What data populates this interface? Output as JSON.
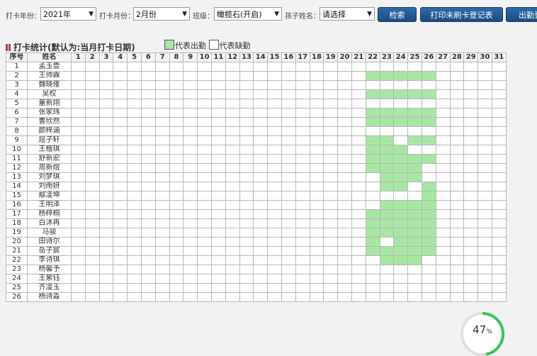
{
  "toolbar": {
    "year_label": "打卡年份：",
    "year_value": "2021年",
    "month_label": "打卡月份：",
    "month_value": "2月份",
    "class_label": "班级：",
    "class_value": "橄榄石(开启)",
    "child_label": "孩子姓名：",
    "child_value": "请选择",
    "search_button": "检索",
    "print_button": "打印未刷卡登记表",
    "export_button": "出勤登"
  },
  "section_title": "打卡统计(默认为:当月打卡日期)",
  "legend": {
    "present": "代表出勤",
    "absent": "代表缺勤"
  },
  "colors": {
    "present": "#a8e6a3",
    "button": "#1f5a97"
  },
  "table": {
    "col_seq": "序号",
    "col_name": "姓名",
    "days": [
      "1",
      "2",
      "3",
      "4",
      "5",
      "6",
      "7",
      "8",
      "9",
      "10",
      "11",
      "12",
      "13",
      "14",
      "15",
      "16",
      "17",
      "18",
      "19",
      "20",
      "21",
      "22",
      "23",
      "24",
      "25",
      "26",
      "27",
      "28",
      "29",
      "30",
      "31"
    ],
    "rows": [
      {
        "seq": "1",
        "name": "孟玉壹",
        "present": []
      },
      {
        "seq": "2",
        "name": "王帅霖",
        "present": [
          22,
          23,
          24,
          25,
          26
        ]
      },
      {
        "seq": "3",
        "name": "魏晓傕",
        "present": []
      },
      {
        "seq": "4",
        "name": "吴权",
        "present": [
          22,
          23,
          24,
          25,
          26
        ]
      },
      {
        "seq": "5",
        "name": "童新翊",
        "present": []
      },
      {
        "seq": "6",
        "name": "张家玮",
        "present": [
          22,
          23,
          24,
          25,
          26
        ]
      },
      {
        "seq": "7",
        "name": "曹欣然",
        "present": [
          22,
          23,
          24,
          25,
          26
        ]
      },
      {
        "seq": "8",
        "name": "颜梓涵",
        "present": []
      },
      {
        "seq": "9",
        "name": "屈子轩",
        "present": [
          22,
          23,
          25,
          26
        ]
      },
      {
        "seq": "10",
        "name": "王楷琪",
        "present": [
          22,
          23,
          24
        ]
      },
      {
        "seq": "11",
        "name": "舒新宏",
        "present": [
          22,
          23,
          24,
          25,
          26
        ]
      },
      {
        "seq": "12",
        "name": "周新煜",
        "present": [
          22,
          23,
          24,
          25
        ]
      },
      {
        "seq": "13",
        "name": "刘梦琪",
        "present": [
          23,
          24,
          25
        ]
      },
      {
        "seq": "14",
        "name": "刘雨妍",
        "present": [
          23,
          24,
          26
        ]
      },
      {
        "seq": "15",
        "name": "鄢凌坤",
        "present": [
          26
        ]
      },
      {
        "seq": "16",
        "name": "王明泽",
        "present": [
          23,
          24,
          25,
          26
        ]
      },
      {
        "seq": "17",
        "name": "杨梓桐",
        "present": [
          22,
          23,
          24,
          25,
          26
        ]
      },
      {
        "seq": "18",
        "name": "白沐冉",
        "present": [
          22,
          23,
          24,
          25,
          26
        ]
      },
      {
        "seq": "19",
        "name": "马骏",
        "present": [
          22,
          23,
          24,
          25,
          26
        ]
      },
      {
        "seq": "20",
        "name": "田诗尔",
        "present": [
          22,
          24,
          25,
          26
        ]
      },
      {
        "seq": "21",
        "name": "岳子宸",
        "present": [
          22,
          23,
          24,
          25,
          26
        ]
      },
      {
        "seq": "22",
        "name": "李诗琪",
        "present": [
          23,
          24,
          25
        ]
      },
      {
        "seq": "23",
        "name": "杨馨予",
        "present": []
      },
      {
        "seq": "24",
        "name": "王紫钰",
        "present": []
      },
      {
        "seq": "25",
        "name": "齐凌玉",
        "present": []
      },
      {
        "seq": "26",
        "name": "杨诗淼",
        "present": []
      }
    ]
  },
  "progress": {
    "value": 47,
    "unit": "%"
  }
}
